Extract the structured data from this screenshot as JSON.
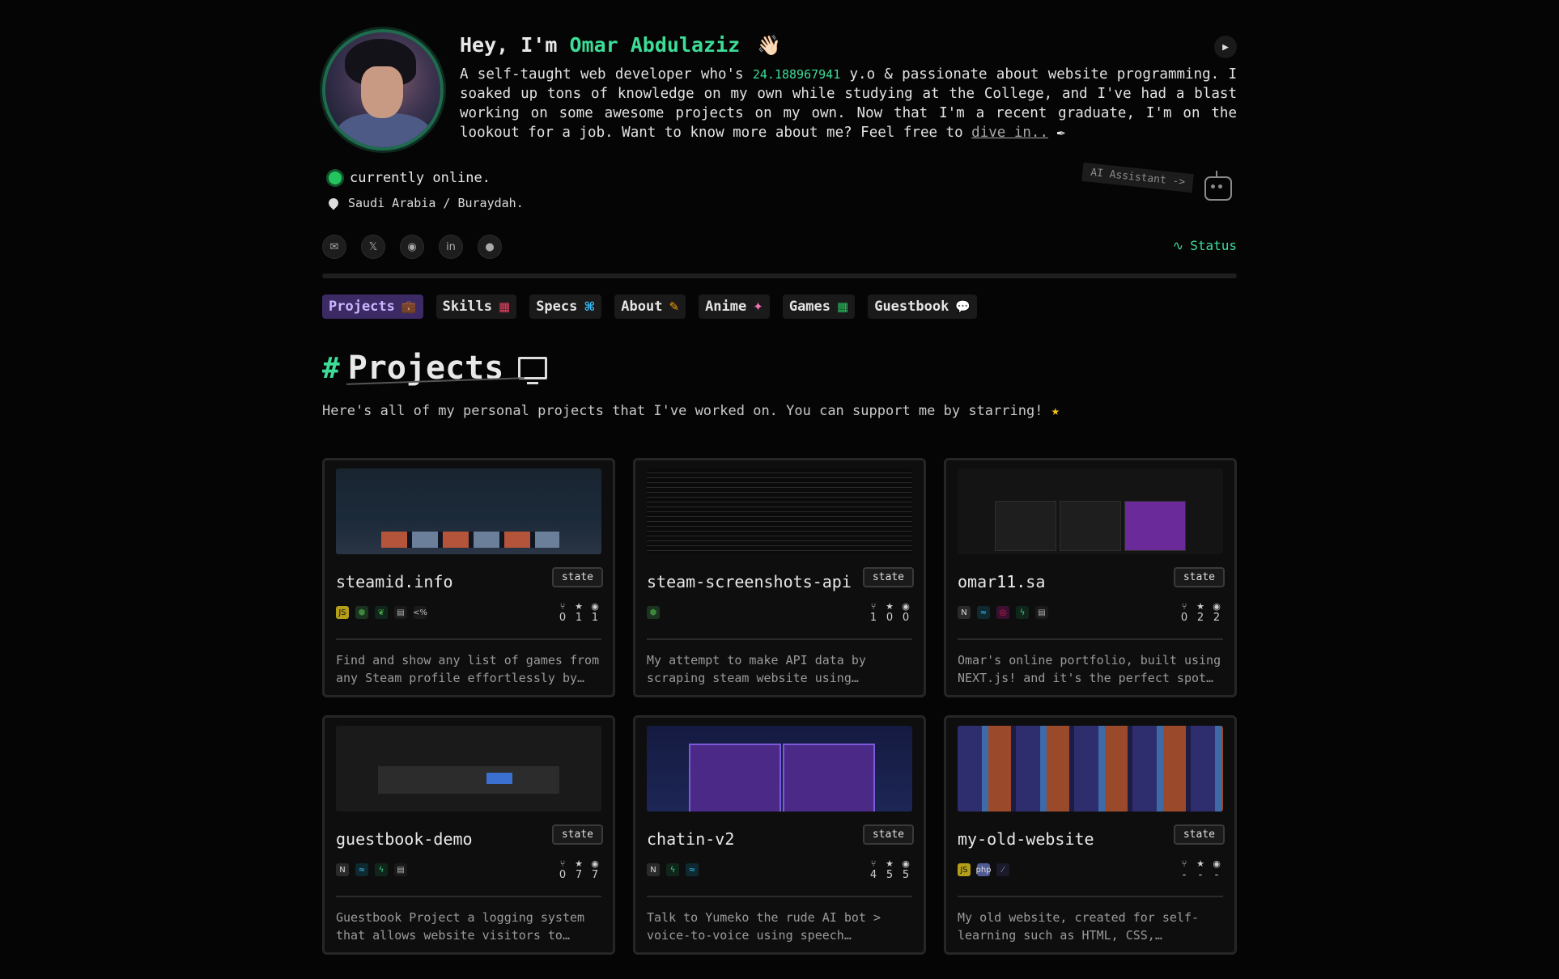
{
  "header": {
    "greeting": "Hey, I'm",
    "name": "Omar Abdulaziz",
    "wave": "👋🏻",
    "bio_1": "A self-taught web developer who's",
    "age": "24.188967941",
    "bio_2": "y.o & passionate about website programming. I soaked up tons of knowledge on my own while studying at the College, and I've had a blast working on some awesome projects on my own. Now that I'm a recent graduate, I'm on the lookout for a job. Want to know more about me? Feel free to",
    "dive_link": "dive in..",
    "pen": "✒",
    "play_icon": "▶",
    "status_text": "currently online.",
    "location": "Saudi Arabia / Buraydah.",
    "ai_label": "AI Assistant ->",
    "status_link": "Status",
    "status_icon": "∿",
    "socials": [
      {
        "name": "email-icon",
        "glyph": "✉"
      },
      {
        "name": "x-icon",
        "glyph": "𝕏"
      },
      {
        "name": "discord-icon",
        "glyph": "◉"
      },
      {
        "name": "linkedin-icon",
        "glyph": "in"
      },
      {
        "name": "github-icon",
        "glyph": "●"
      }
    ]
  },
  "tabs": [
    {
      "label": "Projects",
      "icon": "💼",
      "color": "#a78bfa",
      "active": true
    },
    {
      "label": "Skills",
      "icon": "▦",
      "color": "#f43f5e",
      "active": false
    },
    {
      "label": "Specs",
      "icon": "⌘",
      "color": "#38bdf8",
      "active": false
    },
    {
      "label": "About",
      "icon": "✎",
      "color": "#f59e0b",
      "active": false
    },
    {
      "label": "Anime",
      "icon": "✦",
      "color": "#f472b6",
      "active": false
    },
    {
      "label": "Games",
      "icon": "▦",
      "color": "#22c55e",
      "active": false
    },
    {
      "label": "Guestbook",
      "icon": "💬",
      "color": "#dddddd",
      "active": false
    }
  ],
  "section": {
    "hash": "#",
    "title": "Projects",
    "subtitle": "Here's all of my personal projects that I've worked on. You can support me by starring!",
    "star": "★"
  },
  "projects": [
    {
      "name": "steamid.info",
      "state": "state",
      "forks": "0",
      "stars": "1",
      "views": "1",
      "desc": "Find and show any list of games from any Steam profile effortlessly by simply...",
      "techs": [
        {
          "glyph": "JS",
          "bg": "#b59f1a",
          "fg": "#111"
        },
        {
          "glyph": "⬢",
          "bg": "#1b3320",
          "fg": "#3c873a"
        },
        {
          "glyph": "❦",
          "bg": "#10261a",
          "fg": "#47a248"
        },
        {
          "glyph": "▤",
          "bg": "#1a1a1a",
          "fg": "#bbb"
        },
        {
          "glyph": "<%",
          "bg": "#1a1a1a",
          "fg": "#bbb"
        }
      ]
    },
    {
      "name": "steam-screenshots-api",
      "state": "state",
      "forks": "1",
      "stars": "0",
      "views": "0",
      "desc": "My attempt to make API data by scraping steam website using (puppeteer), for...",
      "techs": [
        {
          "glyph": "⬢",
          "bg": "#1b3320",
          "fg": "#3c873a"
        }
      ]
    },
    {
      "name": "omar11.sa",
      "state": "state",
      "forks": "0",
      "stars": "2",
      "views": "2",
      "desc": "Omar's online portfolio, built using NEXT.js! and it's the perfect spot to...",
      "techs": [
        {
          "glyph": "N",
          "bg": "#2a2a2a",
          "fg": "#ddd"
        },
        {
          "glyph": "≈",
          "bg": "#0e2a30",
          "fg": "#38bdf8"
        },
        {
          "glyph": "◎",
          "bg": "#3a1030",
          "fg": "#e11d48"
        },
        {
          "glyph": "ϟ",
          "bg": "#10261a",
          "fg": "#3ecf8e"
        },
        {
          "glyph": "▤",
          "bg": "#1a1a1a",
          "fg": "#bbb"
        }
      ]
    },
    {
      "name": "guestbook-demo",
      "state": "state",
      "forks": "0",
      "stars": "7",
      "views": "7",
      "desc": "Guestbook Project a logging system that allows website visitors to leave public...",
      "techs": [
        {
          "glyph": "N",
          "bg": "#2a2a2a",
          "fg": "#ddd"
        },
        {
          "glyph": "≈",
          "bg": "#0e2a30",
          "fg": "#38bdf8"
        },
        {
          "glyph": "ϟ",
          "bg": "#10261a",
          "fg": "#3ecf8e"
        },
        {
          "glyph": "▤",
          "bg": "#1a1a1a",
          "fg": "#bbb"
        }
      ]
    },
    {
      "name": "chatin-v2",
      "state": "state",
      "forks": "4",
      "stars": "5",
      "views": "5",
      "desc": "Talk to Yumeko the rude AI bot > voice-to-voice using speech recognition, with...",
      "techs": [
        {
          "glyph": "N",
          "bg": "#2a2a2a",
          "fg": "#ddd"
        },
        {
          "glyph": "ϟ",
          "bg": "#10261a",
          "fg": "#3ecf8e"
        },
        {
          "glyph": "≈",
          "bg": "#0e2a30",
          "fg": "#38bdf8"
        }
      ]
    },
    {
      "name": "my-old-website",
      "state": "state",
      "forks": "-",
      "stars": "-",
      "views": "-",
      "desc": "My old website, created for self-learning such as HTML, CSS, JavaSsript, PHP, API's...",
      "techs": [
        {
          "glyph": "JS",
          "bg": "#b59f1a",
          "fg": "#111"
        },
        {
          "glyph": "php",
          "bg": "#4f5b93",
          "fg": "#ddd"
        },
        {
          "glyph": "⁄",
          "bg": "#1a1a2a",
          "fg": "#8892bf"
        }
      ]
    }
  ],
  "stat_icons": {
    "fork": "⑂",
    "star": "★",
    "eye": "◉"
  }
}
